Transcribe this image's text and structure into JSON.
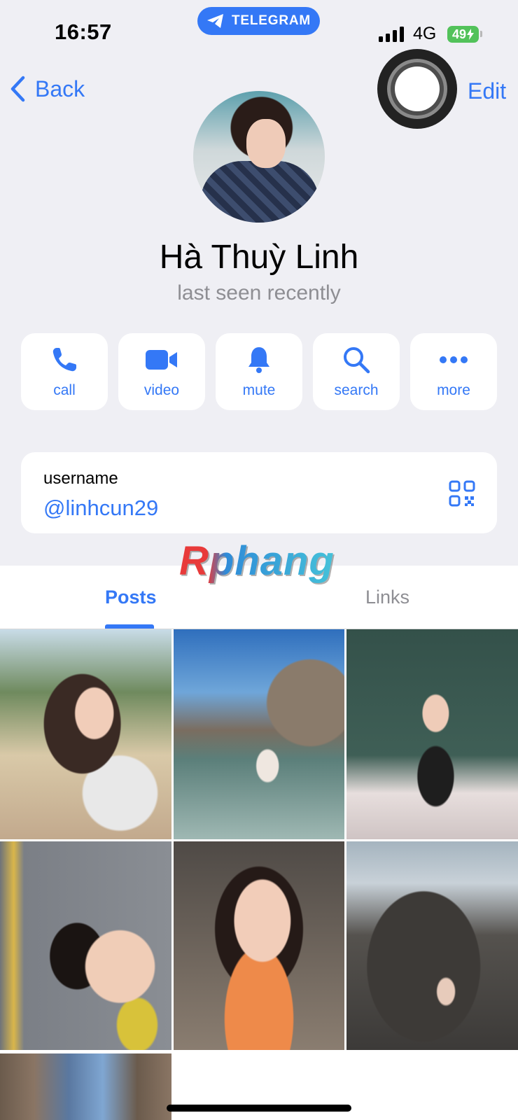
{
  "status_bar": {
    "time": "16:57",
    "app_pill": "TELEGRAM",
    "network": "4G",
    "battery": "49"
  },
  "nav": {
    "back_label": "Back",
    "edit_label": "Edit"
  },
  "profile": {
    "name": "Hà Thuỳ Linh",
    "status": "last seen recently"
  },
  "actions": [
    {
      "label": "call",
      "icon": "phone-icon"
    },
    {
      "label": "video",
      "icon": "video-camera-icon"
    },
    {
      "label": "mute",
      "icon": "bell-icon"
    },
    {
      "label": "search",
      "icon": "search-icon"
    },
    {
      "label": "more",
      "icon": "more-dots-icon"
    }
  ],
  "username": {
    "label": "username",
    "value": "@linhcun29",
    "icon": "qr-code-icon"
  },
  "watermark": "Rphang",
  "tabs": [
    {
      "label": "Posts",
      "active": true
    },
    {
      "label": "Links",
      "active": false
    }
  ],
  "media_count_visible": 7,
  "colors": {
    "accent": "#3478f6",
    "background": "#efeff4",
    "secondary_text": "#8e8e93",
    "battery": "#52c25a"
  }
}
